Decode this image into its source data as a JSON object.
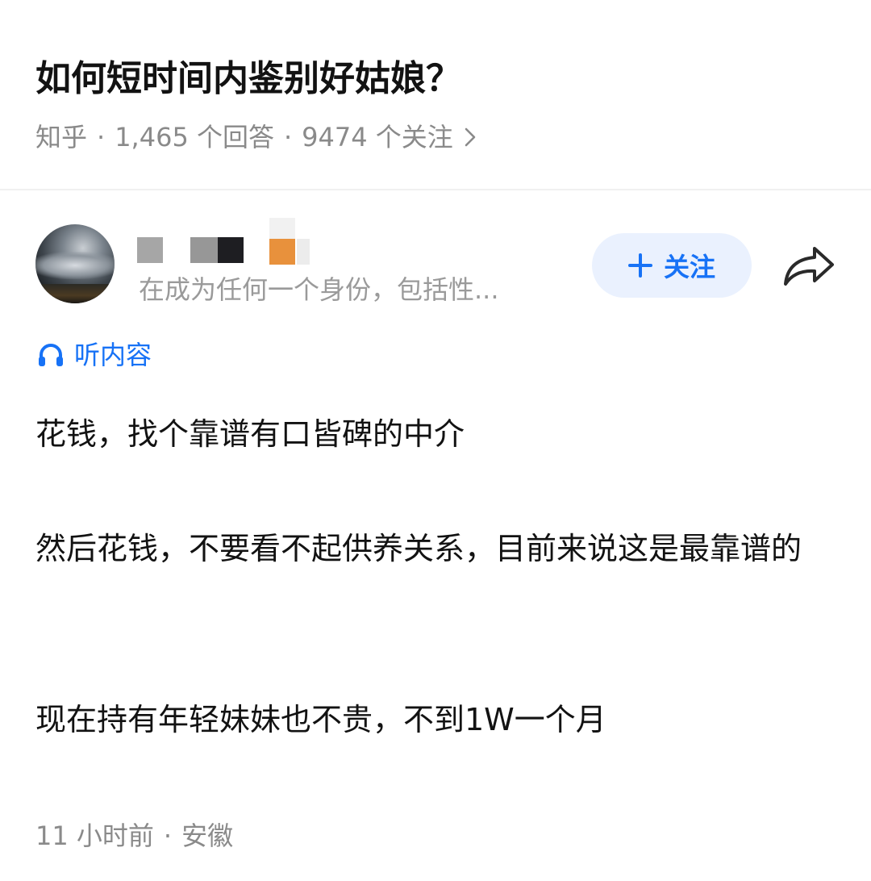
{
  "question": {
    "title": "如何短时间内鉴别好姑娘？",
    "source": "知乎",
    "answers_count": "1,465 个回答",
    "followers_count": "9474 个关注",
    "separator": "·",
    "chevron_icon": "chevron-right-icon"
  },
  "author": {
    "bio": "在成为任何一个身份，包括性...",
    "avatar_icon": "avatar-storm-cloud",
    "follow_label": "关注",
    "follow_icon": "plus-icon",
    "share_icon": "share-arrow-icon"
  },
  "listen": {
    "label": "听内容",
    "icon": "headphones-icon"
  },
  "answer": {
    "paragraphs": [
      "花钱，找个靠谱有口皆碑的中介",
      "然后花钱，不要看不起供养关系，目前来说这是最靠谱的",
      "现在持有年轻妹妹也不贵，不到1W一个月"
    ],
    "time": "11 小时前",
    "location": "安徽",
    "separator": "·"
  },
  "colors": {
    "accent": "#1772f6",
    "follow_bg": "#eaf1fe",
    "title": "#121212",
    "meta": "#8a8a8a",
    "bio": "#9a9a9a",
    "divider": "#f0f0f0",
    "name_blocks": [
      "#a6a6a6",
      "#979797",
      "#1e1e22",
      "#e8913c",
      "#e9e9e9"
    ]
  }
}
